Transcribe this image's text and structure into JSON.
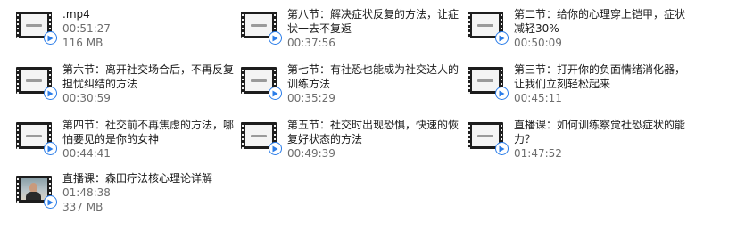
{
  "icons": {
    "thumbnail": "video-thumbnail-icon",
    "badge": "play-circle-icon"
  },
  "colors": {
    "accent": "#2b7de9",
    "text": "#1a1a1a",
    "subtext": "#6d6d6d",
    "hover": "#e5f3ff"
  },
  "files": [
    {
      "name": ".mp4",
      "duration": "00:51:27",
      "size": "116 MB",
      "thumb": "film"
    },
    {
      "name": "第八节：解决症状反复的方法，让症状一去不复返",
      "duration": "00:37:56",
      "size": "",
      "thumb": "film"
    },
    {
      "name": "第二节：给你的心理穿上铠甲，症状减轻30%",
      "duration": "00:50:09",
      "size": "",
      "thumb": "film"
    },
    {
      "name": "第六节：离开社交场合后，不再反复担忧纠结的方法",
      "duration": "00:30:59",
      "size": "",
      "thumb": "film"
    },
    {
      "name": "第七节：有社恐也能成为社交达人的训练方法",
      "duration": "00:35:29",
      "size": "",
      "thumb": "film"
    },
    {
      "name": "第三节：打开你的负面情绪消化器，让我们立刻轻松起来",
      "duration": "00:45:11",
      "size": "",
      "thumb": "film"
    },
    {
      "name": "第四节：社交前不再焦虑的方法，哪怕要见的是你的女神",
      "duration": "00:44:41",
      "size": "",
      "thumb": "film"
    },
    {
      "name": "第五节：社交时出现恐惧，快速的恢复好状态的方法",
      "duration": "00:49:39",
      "size": "",
      "thumb": "film"
    },
    {
      "name": "直播课：如何训练察觉社恐症状的能力？",
      "duration": "01:47:52",
      "size": "",
      "thumb": "film"
    },
    {
      "name": "直播课：森田疗法核心理论详解",
      "duration": "01:48:38",
      "size": "337 MB",
      "thumb": "photo"
    }
  ]
}
